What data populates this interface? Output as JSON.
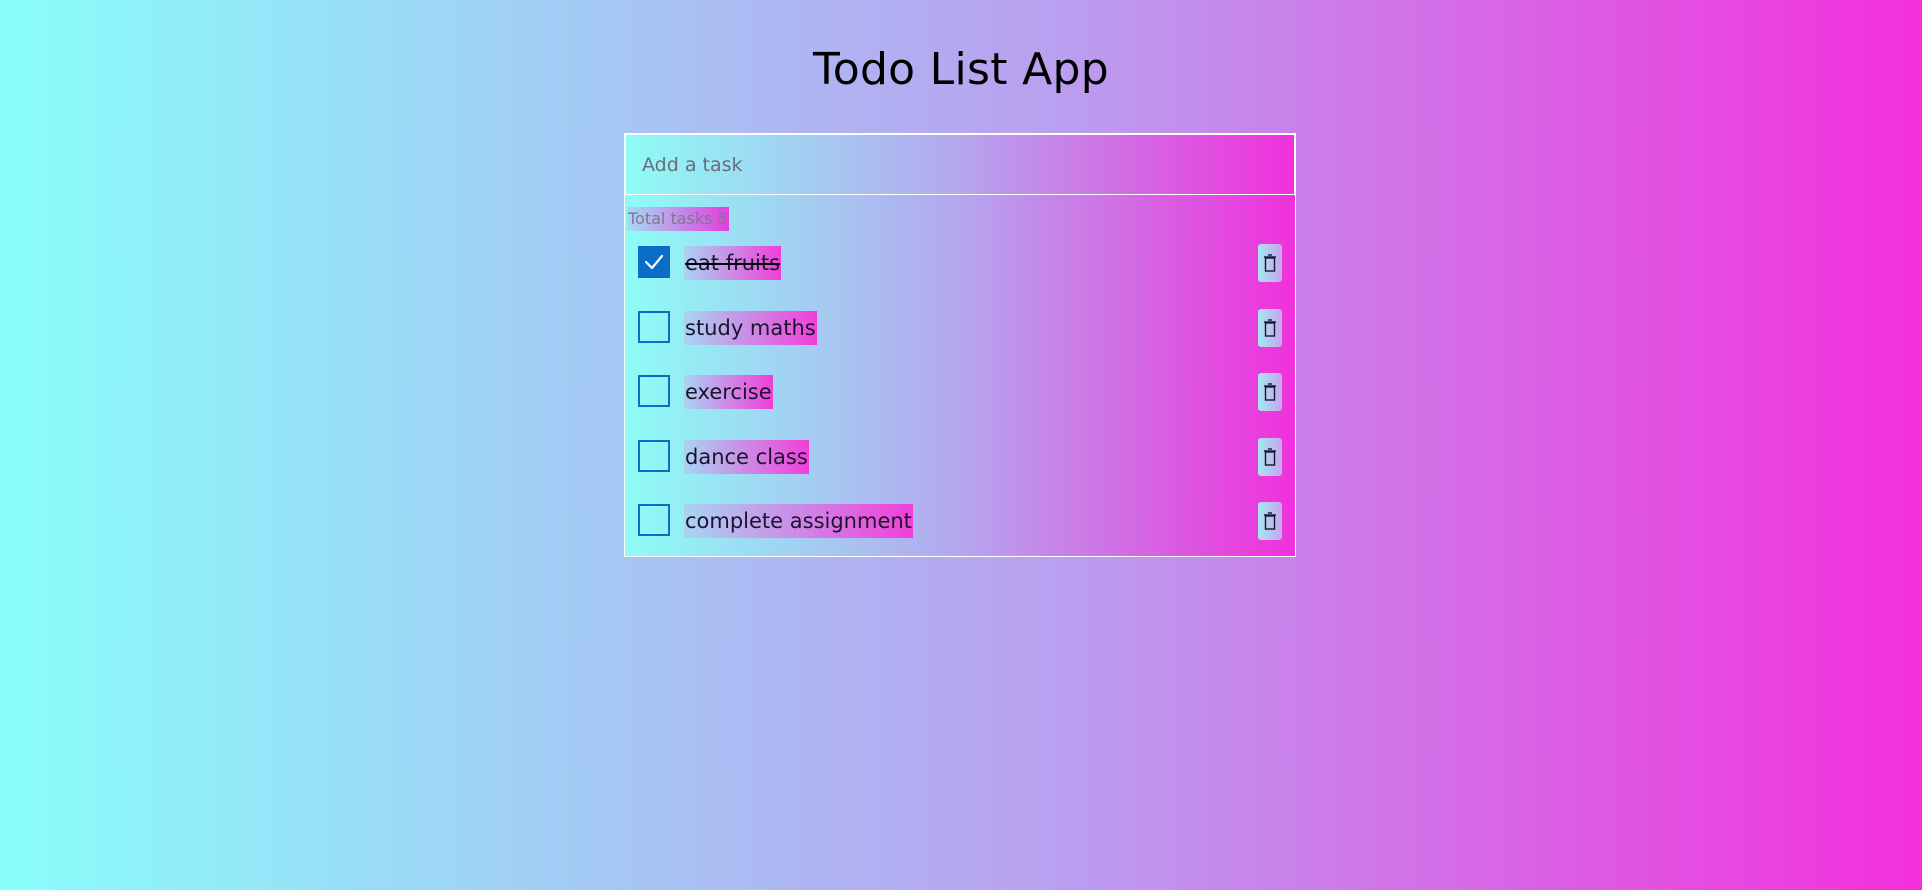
{
  "app": {
    "title": "Todo List App"
  },
  "input": {
    "placeholder": "Add a task",
    "value": ""
  },
  "summary": {
    "total_label": "Total tasks 5"
  },
  "colors": {
    "accent": "#0a6ec6",
    "gradient_start": "#88fefa",
    "gradient_end": "#f42fdc"
  },
  "tasks": [
    {
      "label": "eat fruits",
      "done": true
    },
    {
      "label": "study maths",
      "done": false
    },
    {
      "label": "exercise",
      "done": false
    },
    {
      "label": "dance class",
      "done": false
    },
    {
      "label": "complete assignment",
      "done": false
    }
  ],
  "icons": {
    "check": "check-icon",
    "delete": "trash-icon"
  }
}
